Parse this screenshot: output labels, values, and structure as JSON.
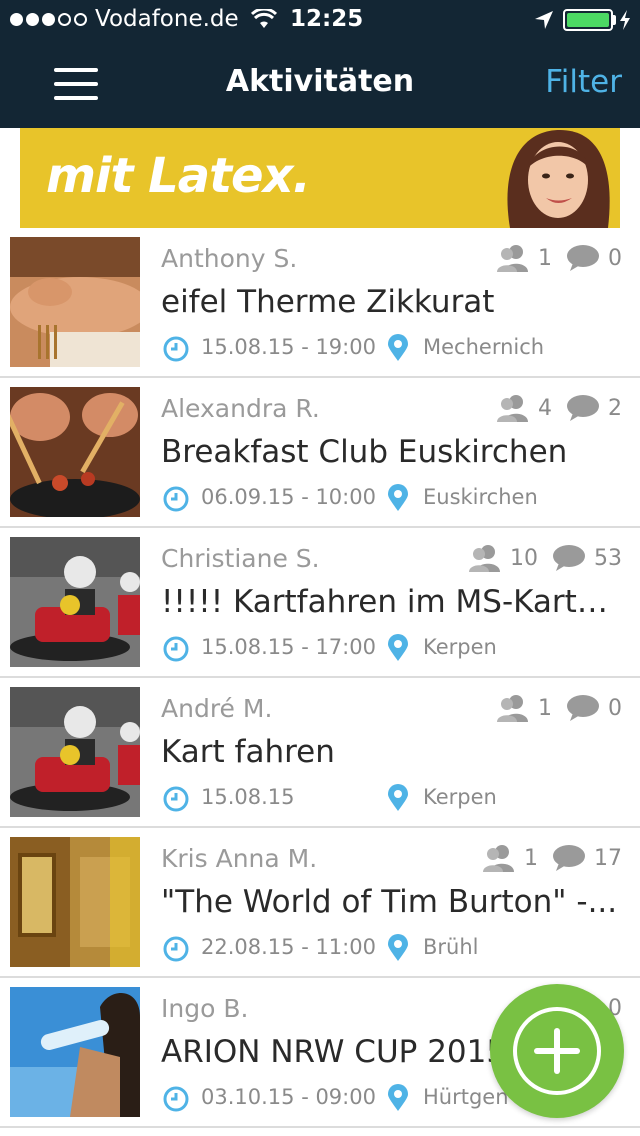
{
  "status_bar": {
    "carrier": "Vodafone.de",
    "time": "12:25"
  },
  "nav": {
    "title": "Aktivitäten",
    "filter_label": "Filter"
  },
  "banner": {
    "text": "mit Latex."
  },
  "colors": {
    "nav_bg": "#132634",
    "accent": "#4fb3e6",
    "fab": "#79c143",
    "banner": "#e8c42a"
  },
  "activities": [
    {
      "author": "Anthony S.",
      "title": "eifel Therme Zikkurat",
      "date": "15.08.15 - 19:00",
      "place": "Mechernich",
      "participants": "1",
      "comments": "0"
    },
    {
      "author": "Alexandra R.",
      "title": "Breakfast Club Euskirchen",
      "date": "06.09.15 - 10:00",
      "place": "Euskirchen",
      "participants": "4",
      "comments": "2"
    },
    {
      "author": "Christiane S.",
      "title": "!!!!! Kartfahren im MS-Kartce...",
      "date": "15.08.15 - 17:00",
      "place": "Kerpen",
      "participants": "10",
      "comments": "53"
    },
    {
      "author": "André M.",
      "title": "Kart fahren",
      "date": "15.08.15",
      "place": "Kerpen",
      "participants": "1",
      "comments": "0"
    },
    {
      "author": "Kris Anna M.",
      "title": "\"The World of Tim Burton\" -...",
      "date": "22.08.15 - 11:00",
      "place": "Brühl",
      "participants": "1",
      "comments": "17"
    },
    {
      "author": "Ingo B.",
      "title": "ARION NRW CUP 2015",
      "date": "03.10.15 - 09:00",
      "place": "Hürtgen",
      "participants": "",
      "comments": "0"
    }
  ],
  "icons": {
    "menu": "hamburger-icon",
    "participants": "people-icon",
    "comments": "speech-bubble-icon",
    "date": "clock-icon",
    "place": "location-pin-icon",
    "add": "plus-icon"
  }
}
